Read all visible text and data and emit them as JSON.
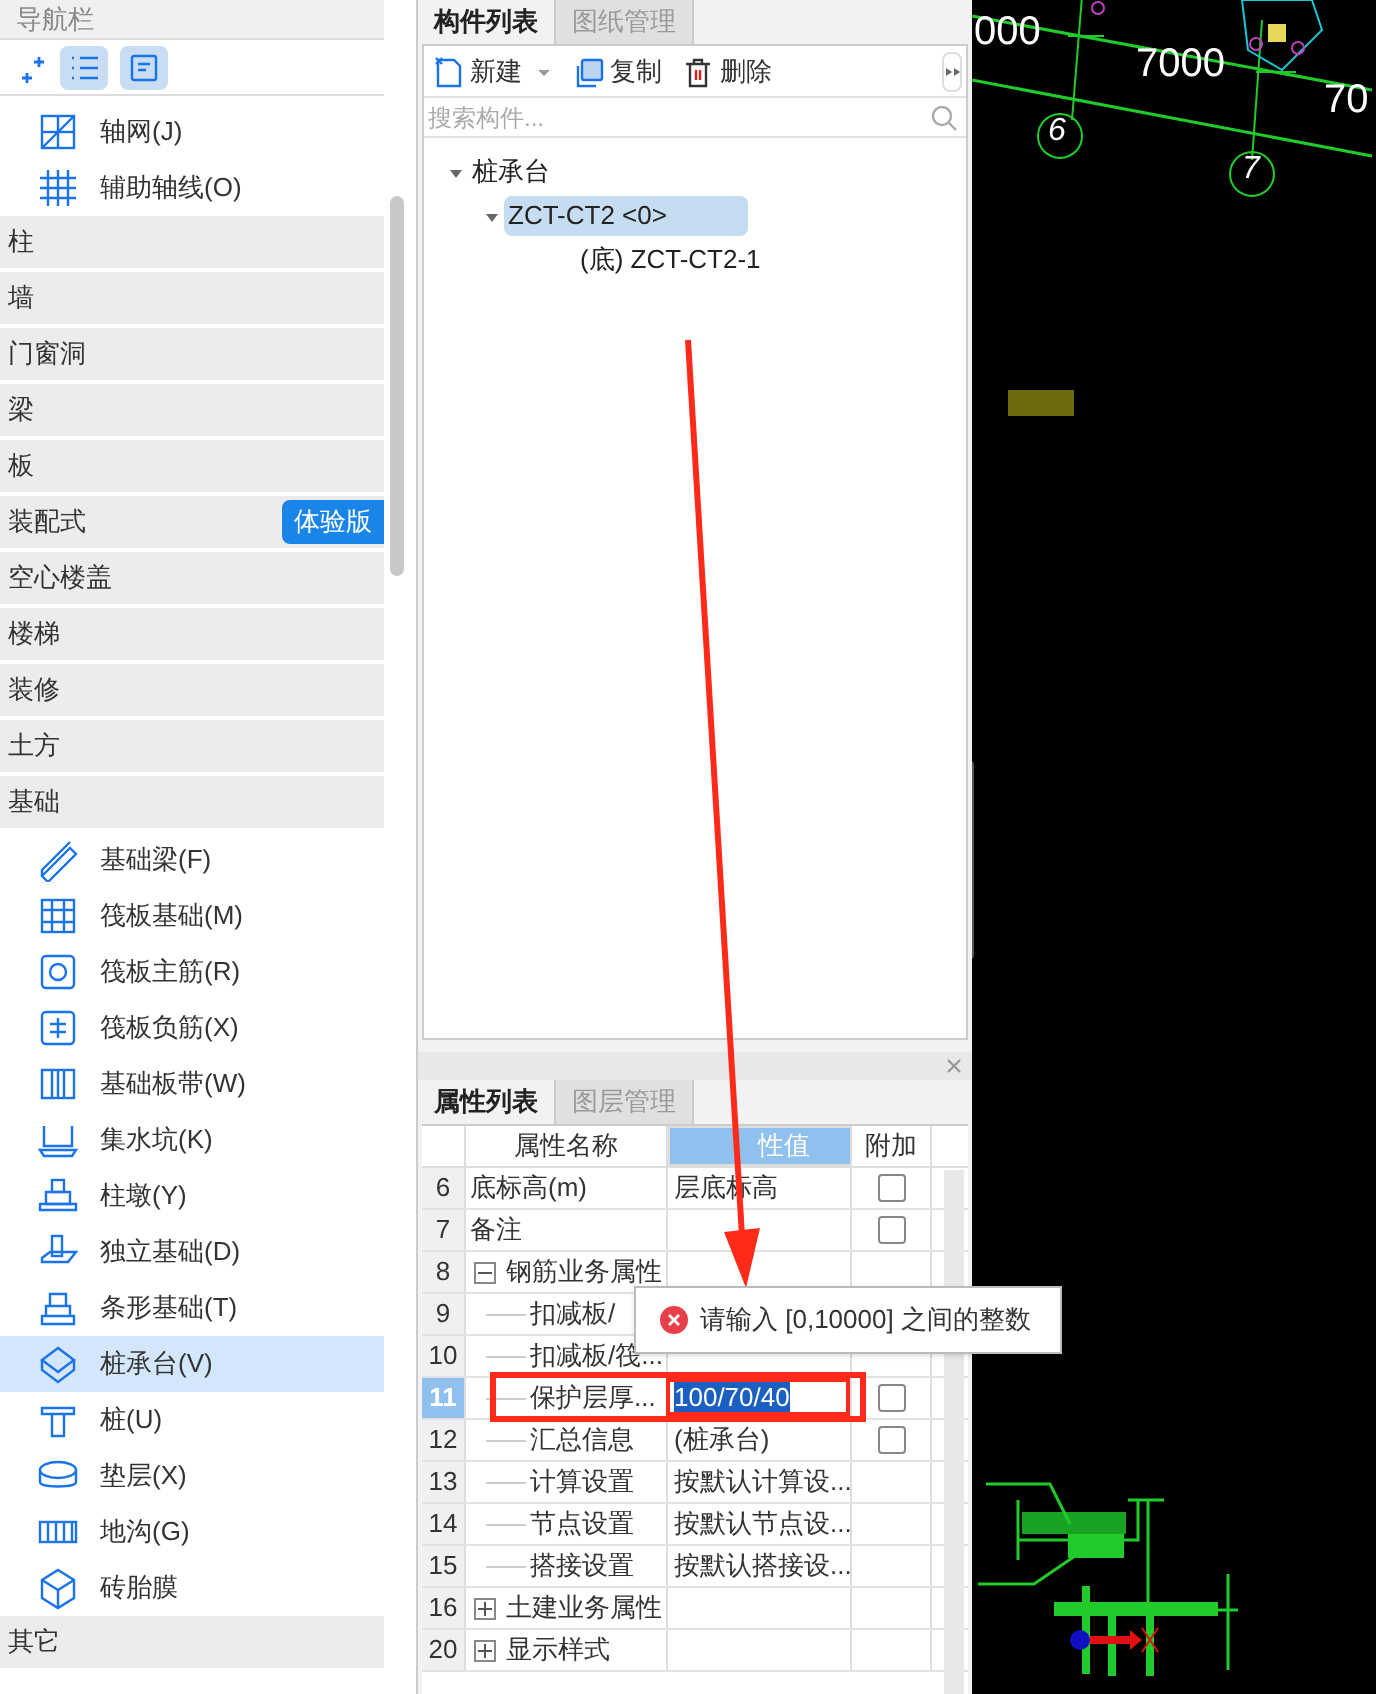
{
  "nav": {
    "title": "导航栏",
    "items": [
      {
        "kind": "tool",
        "label": "轴网(J)",
        "selected": false
      },
      {
        "kind": "tool",
        "label": "辅助轴线(O)",
        "selected": false
      },
      {
        "kind": "category",
        "label": "柱"
      },
      {
        "kind": "category",
        "label": "墙"
      },
      {
        "kind": "category",
        "label": "门窗洞"
      },
      {
        "kind": "category",
        "label": "梁"
      },
      {
        "kind": "category",
        "label": "板"
      },
      {
        "kind": "category",
        "label": "装配式",
        "badge": "体验版"
      },
      {
        "kind": "category",
        "label": "空心楼盖"
      },
      {
        "kind": "category",
        "label": "楼梯"
      },
      {
        "kind": "category",
        "label": "装修"
      },
      {
        "kind": "category",
        "label": "土方"
      },
      {
        "kind": "category",
        "label": "基础",
        "children": [
          {
            "label": "基础梁(F)",
            "selected": false
          },
          {
            "label": "筏板基础(M)",
            "selected": false
          },
          {
            "label": "筏板主筋(R)",
            "selected": false
          },
          {
            "label": "筏板负筋(X)",
            "selected": false
          },
          {
            "label": "基础板带(W)",
            "selected": false
          },
          {
            "label": "集水坑(K)",
            "selected": false
          },
          {
            "label": "柱墩(Y)",
            "selected": false
          },
          {
            "label": "独立基础(D)",
            "selected": false
          },
          {
            "label": "条形基础(T)",
            "selected": false
          },
          {
            "label": "桩承台(V)",
            "selected": true
          },
          {
            "label": "桩(U)",
            "selected": false
          },
          {
            "label": "垫层(X)",
            "selected": false
          },
          {
            "label": "地沟(G)",
            "selected": false
          },
          {
            "label": "砖胎膜",
            "selected": false
          }
        ]
      },
      {
        "kind": "category",
        "label": "其它"
      }
    ]
  },
  "component_panel": {
    "tabs": [
      {
        "label": "构件列表",
        "selected": true
      },
      {
        "label": "图纸管理",
        "selected": false
      }
    ],
    "toolbar": [
      {
        "label": "新建",
        "dropdown": true
      },
      {
        "label": "复制",
        "dropdown": false
      },
      {
        "label": "删除",
        "dropdown": false
      }
    ],
    "search": {
      "placeholder": "搜索构件..."
    },
    "tree": [
      {
        "label": "桩承台",
        "expanded": true,
        "selected": false,
        "children": [
          {
            "label": "ZCT-CT2 <0>",
            "expanded": true,
            "selected": true,
            "children": [
              {
                "label": "(底) ZCT-CT2-1",
                "selected": false
              }
            ]
          }
        ]
      }
    ]
  },
  "property_panel": {
    "tabs": [
      {
        "label": "属性列表",
        "selected": true
      },
      {
        "label": "图层管理",
        "selected": false
      }
    ],
    "columns": [
      "属性名称",
      "性值",
      "附加"
    ],
    "rows": [
      {
        "kind": "field",
        "no": "6",
        "name": "底标高(m)",
        "value": "层底标高",
        "checked": false,
        "selected": false
      },
      {
        "kind": "field",
        "no": "7",
        "name": "备注",
        "checked": false,
        "selected": false
      },
      {
        "kind": "group",
        "no": "8",
        "name": "钢筋业务属性",
        "expanded": true,
        "selected": false
      },
      {
        "kind": "child",
        "no": "9",
        "name": "扣减板/",
        "selected": false
      },
      {
        "kind": "child",
        "no": "10",
        "name": "扣减板/筏...",
        "selected": false
      },
      {
        "kind": "child",
        "no": "11",
        "name": "保护层厚...",
        "value": "100/70/40",
        "editing": true,
        "checked": false,
        "selected": true
      },
      {
        "kind": "child",
        "no": "12",
        "name": "汇总信息",
        "value": "(桩承台)",
        "checked": false,
        "selected": false
      },
      {
        "kind": "child",
        "no": "13",
        "name": "计算设置",
        "value": "按默认计算设...",
        "selected": false
      },
      {
        "kind": "child",
        "no": "14",
        "name": "节点设置",
        "value": "按默认节点设...",
        "selected": false
      },
      {
        "kind": "child",
        "no": "15",
        "name": "搭接设置",
        "value": "按默认搭接设...",
        "selected": false
      },
      {
        "kind": "group",
        "no": "16",
        "name": "土建业务属性",
        "expanded": false,
        "selected": false
      },
      {
        "kind": "group",
        "no": "20",
        "name": "显示样式",
        "expanded": false,
        "selected": false
      }
    ],
    "error_tooltip": "请输入 [0,10000] 之间的整数"
  },
  "canvas": {
    "labels": [
      {
        "text": "000",
        "kind": "dim"
      },
      {
        "text": "7000",
        "kind": "dim"
      },
      {
        "text": "70",
        "kind": "dim"
      },
      {
        "text": "6",
        "kind": "axis"
      },
      {
        "text": "7",
        "kind": "axis"
      }
    ]
  }
}
